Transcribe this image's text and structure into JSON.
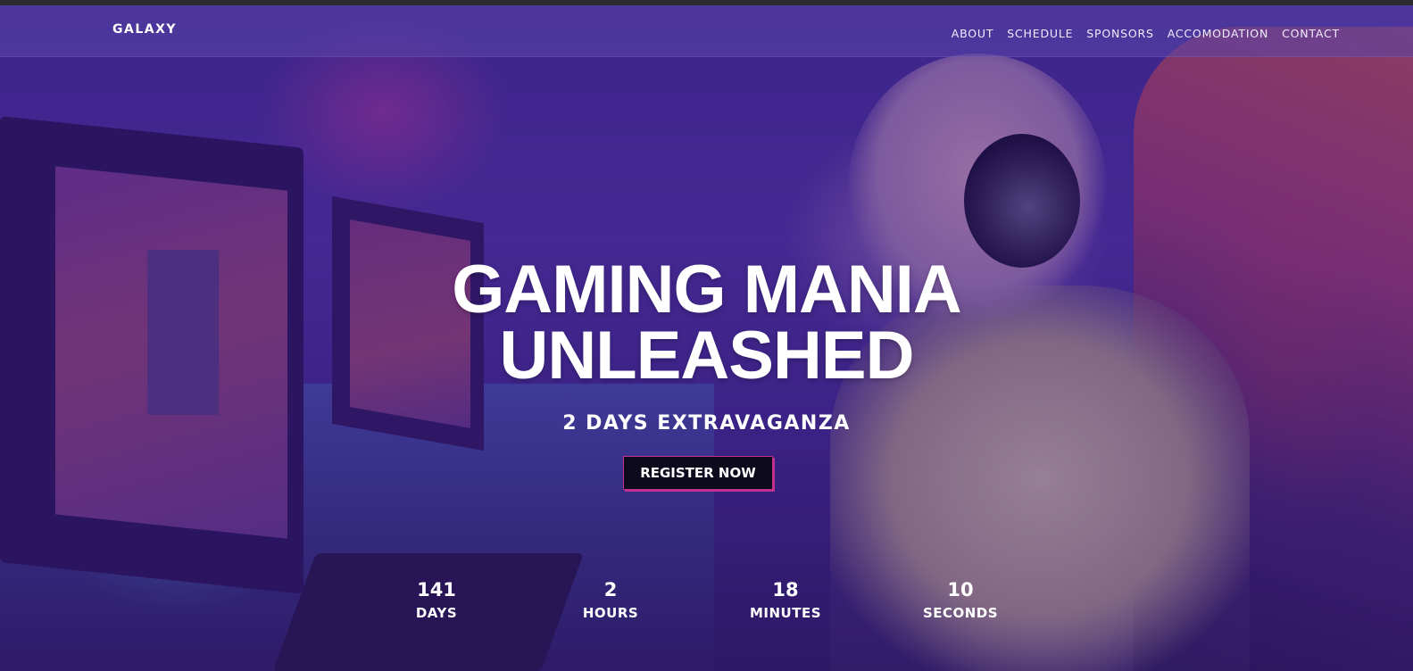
{
  "header": {
    "brand": "GALAXY",
    "nav": [
      {
        "label": "ABOUT"
      },
      {
        "label": "SCHEDULE"
      },
      {
        "label": "SPONSORS"
      },
      {
        "label": "ACCOMODATION"
      },
      {
        "label": "CONTACT"
      }
    ]
  },
  "hero": {
    "title_line1": "GAMING MANIA",
    "title_line2": "UNLEASHED",
    "subtitle": "2 DAYS EXTRAVAGANZA",
    "cta_label": "REGISTER NOW",
    "background_image": "gamer-with-headset-at-esports-event",
    "accent_color": "#c2308e"
  },
  "countdown": [
    {
      "value": "141",
      "label": "DAYS"
    },
    {
      "value": "2",
      "label": "HOURS"
    },
    {
      "value": "18",
      "label": "MINUTES"
    },
    {
      "value": "10",
      "label": "SECONDS"
    }
  ]
}
